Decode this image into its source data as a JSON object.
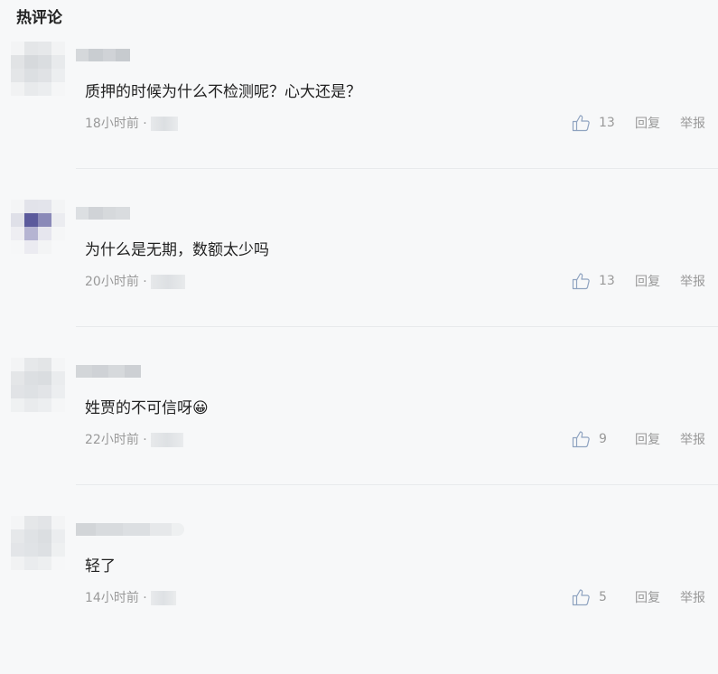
{
  "section": {
    "title": "热评论"
  },
  "comments": [
    {
      "text": "质押的时候为什么不检测呢？心大还是？",
      "time": "18小时前 ·",
      "likes": "13",
      "reply": "回复",
      "report": "举报"
    },
    {
      "text": "为什么是无期，数额太少吗",
      "time": "20小时前 ·",
      "likes": "13",
      "reply": "回复",
      "report": "举报"
    },
    {
      "text": "姓贾的不可信呀😀",
      "time": "22小时前 ·",
      "likes": "9",
      "reply": "回复",
      "report": "举报"
    },
    {
      "text": "轻了",
      "time": "14小时前 ·",
      "likes": "5",
      "reply": "回复",
      "report": "举报"
    }
  ],
  "icons": {
    "like": "thumbs-up-icon"
  },
  "colors": {
    "text": "#222222",
    "meta": "#999999",
    "background": "#f7f8f9",
    "divider": "#e8eaec"
  }
}
